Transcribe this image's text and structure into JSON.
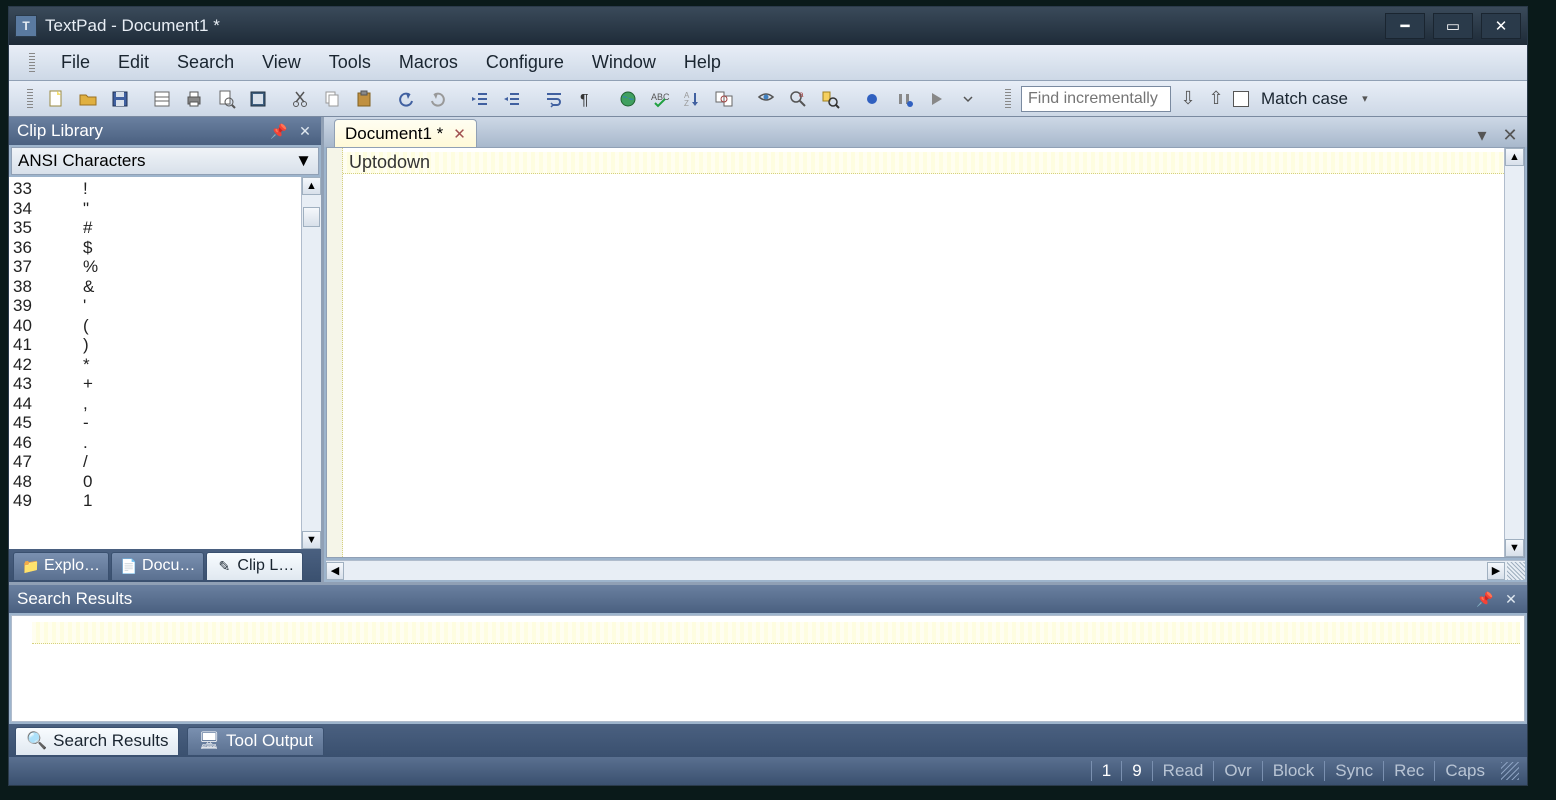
{
  "titlebar": {
    "app": "TextPad",
    "doc": "Document1 *"
  },
  "menu": [
    "File",
    "Edit",
    "Search",
    "View",
    "Tools",
    "Macros",
    "Configure",
    "Window",
    "Help"
  ],
  "find": {
    "placeholder": "Find incrementally",
    "match_case_label": "Match case"
  },
  "clip_library": {
    "title": "Clip Library",
    "combo": "ANSI Characters",
    "rows": [
      {
        "c": "33",
        "g": "!"
      },
      {
        "c": "34",
        "g": "\""
      },
      {
        "c": "35",
        "g": "#"
      },
      {
        "c": "36",
        "g": "$"
      },
      {
        "c": "37",
        "g": "%"
      },
      {
        "c": "38",
        "g": "&"
      },
      {
        "c": "39",
        "g": "'"
      },
      {
        "c": "40",
        "g": "("
      },
      {
        "c": "41",
        "g": ")"
      },
      {
        "c": "42",
        "g": "*"
      },
      {
        "c": "43",
        "g": "+"
      },
      {
        "c": "44",
        "g": ","
      },
      {
        "c": "45",
        "g": "-"
      },
      {
        "c": "46",
        "g": "."
      },
      {
        "c": "47",
        "g": "/"
      },
      {
        "c": "48",
        "g": "0"
      },
      {
        "c": "49",
        "g": "1"
      }
    ],
    "tabs": [
      "Explo…",
      "Docu…",
      "Clip L…"
    ]
  },
  "doc_tab": "Document1 *",
  "editor_text": "Uptodown",
  "search_results": {
    "title": "Search Results"
  },
  "bottom_tabs": [
    "Search Results",
    "Tool Output"
  ],
  "status": {
    "line": "1",
    "col": "9",
    "flags": [
      "Read",
      "Ovr",
      "Block",
      "Sync",
      "Rec",
      "Caps"
    ]
  }
}
